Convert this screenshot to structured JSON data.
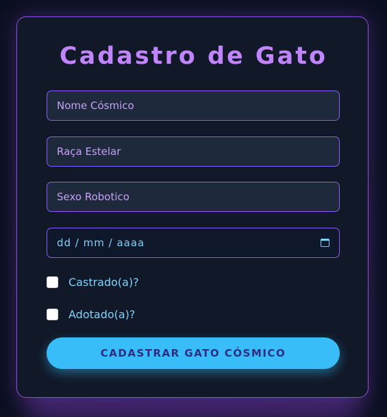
{
  "form": {
    "title": "Cadastro de Gato",
    "fields": [
      {
        "placeholder": "Nome Cósmico"
      },
      {
        "placeholder": "Raça Estelar"
      },
      {
        "placeholder": "Sexo Robotico"
      }
    ],
    "date": {
      "placeholder": "dd / mm / aaaa",
      "icon": "calendar-icon"
    },
    "checkboxes": [
      {
        "label": "Castrado(a)?",
        "checked": false
      },
      {
        "label": "Adotado(a)?",
        "checked": false
      }
    ],
    "submit_label": "CADASTRAR GATO CÓSMICO"
  },
  "colors": {
    "accent_purple": "#c084fc",
    "border_purple": "#8b5cf6",
    "accent_cyan": "#38bdf8",
    "button_text": "#312e81",
    "card_bg": "#111827"
  }
}
